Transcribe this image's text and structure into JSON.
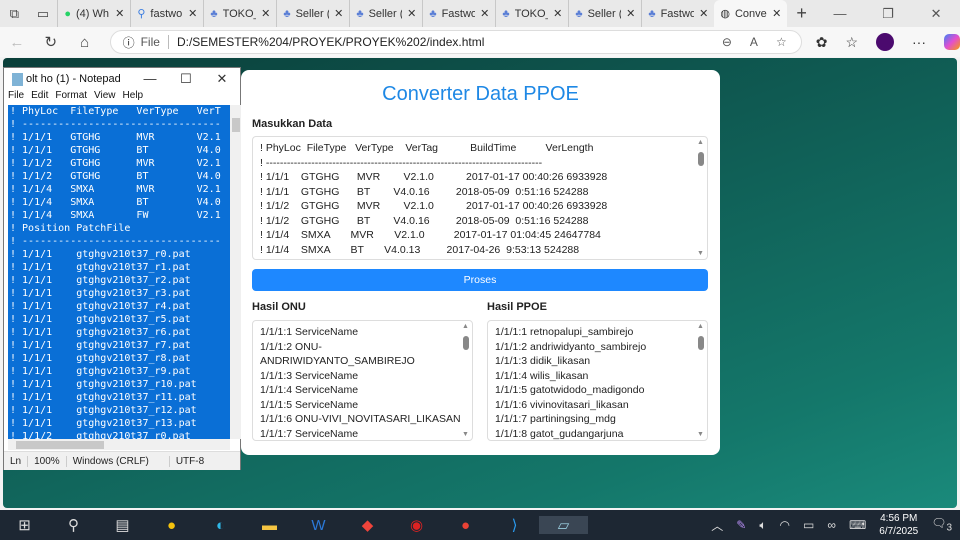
{
  "browser": {
    "tabs": [
      {
        "icon": "whatsapp-icon",
        "title": "(4) Wh"
      },
      {
        "icon": "search-icon",
        "title": "fastwo"
      },
      {
        "icon": "app-icon",
        "title": "TOKO_"
      },
      {
        "icon": "app-icon",
        "title": "Seller ("
      },
      {
        "icon": "app-icon",
        "title": "Seller ("
      },
      {
        "icon": "app-icon",
        "title": "Fastwo"
      },
      {
        "icon": "app-icon",
        "title": "TOKO_"
      },
      {
        "icon": "app-icon",
        "title": "Seller ("
      },
      {
        "icon": "app-icon",
        "title": "Fastwo"
      },
      {
        "icon": "globe-icon",
        "title": "Conve",
        "active": true
      }
    ],
    "address_prefix": "File",
    "url": "D:/SEMESTER%204/PROYEK/PROYEK%202/index.html"
  },
  "notepad": {
    "title": "olt ho (1) - Notepad",
    "menu": [
      "File",
      "Edit",
      "Format",
      "View",
      "Help"
    ],
    "lines": [
      "! PhyLoc  FileType   VerType   VerT",
      "! ---------------------------------",
      "! 1/1/1   GTGHG      MVR       V2.1",
      "! 1/1/1   GTGHG      BT        V4.0",
      "! 1/1/2   GTGHG      MVR       V2.1",
      "! 1/1/2   GTGHG      BT        V4.0",
      "! 1/1/4   SMXA       MVR       V2.1",
      "! 1/1/4   SMXA       BT        V4.0",
      "! 1/1/4   SMXA       FW        V2.1",
      "! Position PatchFile",
      "! ---------------------------------",
      "! 1/1/1    gtghgv210t37_r0.pat",
      "! 1/1/1    gtghgv210t37_r1.pat",
      "! 1/1/1    gtghgv210t37_r2.pat",
      "! 1/1/1    gtghgv210t37_r3.pat",
      "! 1/1/1    gtghgv210t37_r4.pat",
      "! 1/1/1    gtghgv210t37_r5.pat",
      "! 1/1/1    gtghgv210t37_r6.pat",
      "! 1/1/1    gtghgv210t37_r7.pat",
      "! 1/1/1    gtghgv210t37_r8.pat",
      "! 1/1/1    gtghgv210t37_r9.pat",
      "! 1/1/1    gtghgv210t37_r10.pat",
      "! 1/1/1    gtghgv210t37_r11.pat",
      "! 1/1/1    gtghgv210t37_r12.pat",
      "! 1/1/1    gtghgv210t37_r13.pat",
      "! 1/1/2    gtghgv210t37_r0.pat"
    ],
    "status": {
      "ln": "Ln",
      "zoom": "100%",
      "eol": "Windows (CRLF)",
      "encoding": "UTF-8"
    }
  },
  "page": {
    "title": "Converter Data PPOE",
    "input_label": "Masukkan Data",
    "input_lines": [
      "! PhyLoc  FileType   VerType    VerTag           BuildTime          VerLength",
      "! -------------------------------------------------------------------------------",
      "! 1/1/1    GTGHG      MVR        V2.1.0           2017-01-17 00:40:26 6933928",
      "! 1/1/1    GTGHG      BT        V4.0.16         2018-05-09  0:51:16 524288",
      "! 1/1/2    GTGHG      MVR        V2.1.0           2017-01-17 00:40:26 6933928",
      "! 1/1/2    GTGHG      BT        V4.0.16         2018-05-09  0:51:16 524288",
      "! 1/1/4    SMXA       MVR       V2.1.0          2017-01-17 01:04:45 24647784",
      "! 1/1/4    SMXA       BT       V4.0.13         2017-04-26  9:53:13 524288"
    ],
    "button": "Proses",
    "onu_label": "Hasil ONU",
    "onu_lines": [
      "1/1/1:1 ServiceName",
      "1/1/1:2 ONU-",
      "ANDRIWIDYANTO_SAMBIREJO",
      "1/1/1:3 ServiceName",
      "1/1/1:4 ServiceName",
      "1/1/1:5 ServiceName",
      "1/1/1:6 ONU-VIVI_NOVITASARI_LIKASAN",
      "1/1/1:7 ServiceName"
    ],
    "ppoe_label": "Hasil PPOE",
    "ppoe_lines": [
      "1/1/1:1 retnopalupi_sambirejo",
      "1/1/1:2 andriwidyanto_sambirejo",
      "1/1/1:3 didik_likasan",
      "1/1/1:4 wilis_likasan",
      "1/1/1:5 gatotwidodo_madigondo",
      "1/1/1:6 vivinovitasari_likasan",
      "1/1/1:7 partiningsing_mdg",
      "1/1/1:8 gatot_gudangarjuna"
    ]
  },
  "taskbar": {
    "time": "4:56 PM",
    "date": "6/7/2025",
    "notifications": "3"
  }
}
